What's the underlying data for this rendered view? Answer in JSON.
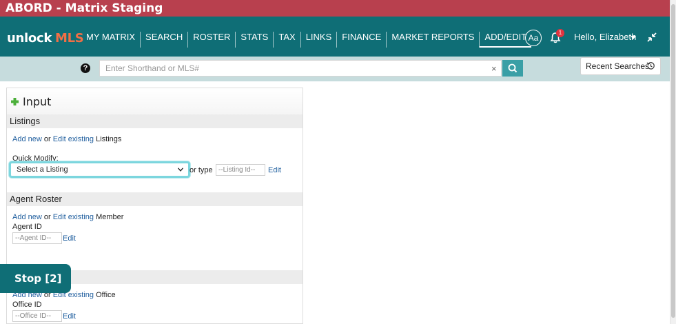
{
  "window": {
    "title": "ABORD - Matrix Staging"
  },
  "brand": {
    "logo_part1": "unlock",
    "logo_part2": "MLS",
    "accent": "#f26f45",
    "nav_bg": "#0f6e76"
  },
  "nav": {
    "items": [
      {
        "label": "MY MATRIX"
      },
      {
        "label": "SEARCH"
      },
      {
        "label": "ROSTER"
      },
      {
        "label": "STATS"
      },
      {
        "label": "TAX"
      },
      {
        "label": "LINKS"
      },
      {
        "label": "FINANCE"
      },
      {
        "label": "MARKET REPORTS"
      },
      {
        "label": "ADD/EDIT"
      }
    ],
    "active": "ADD/EDIT",
    "aa_label": "Aa",
    "notifications_count": "1",
    "greeting": "Hello, Elizabeth"
  },
  "search": {
    "help": "?",
    "placeholder": "Enter Shorthand or MLS#",
    "clear": "×",
    "recent_label": "Recent Searches"
  },
  "panel": {
    "title": "Input",
    "listings": {
      "header": "Listings",
      "add_new": "Add new",
      "or": "or",
      "edit_existing": "Edit existing",
      "noun": "Listings",
      "quick_modify": "Quick Modify:",
      "select_value": "Select a Listing",
      "or_type": "or type",
      "id_placeholder": "--Listing Id--",
      "edit": "Edit"
    },
    "agent": {
      "header": "Agent Roster",
      "add_new": "Add new",
      "or": "or",
      "edit_existing": "Edit existing",
      "noun": "Member",
      "id_label": "Agent ID",
      "id_placeholder": "--Agent ID--",
      "edit": "Edit"
    },
    "office": {
      "add_new": "Add new",
      "or": "or",
      "edit_existing": "Edit existing",
      "noun": "Office",
      "id_label": "Office ID",
      "id_placeholder": "--Office ID--",
      "edit": "Edit"
    }
  },
  "overlay": {
    "stop_label": "Stop [2]"
  }
}
